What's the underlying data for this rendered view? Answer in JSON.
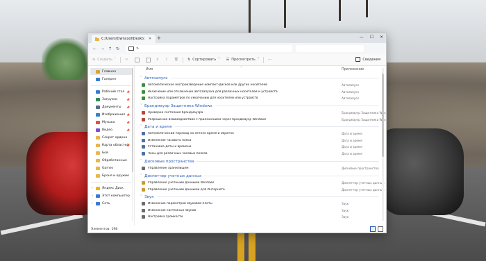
{
  "window": {
    "tab_title": "C:\\Users\\Owncool\\Desktop\\Go",
    "new_tab": "+",
    "controls": [
      "—",
      "☐",
      "✕"
    ]
  },
  "address": {
    "path_separator": ">"
  },
  "toolbar": {
    "create_label": "Создать",
    "sort_label": "Сортировать",
    "view_label": "Просмотреть",
    "more_label": "···",
    "details_label": "Сведения"
  },
  "sidebar": {
    "items": [
      {
        "label": "Главная",
        "icon": "home-icon",
        "color": "#d7a437",
        "selected": true
      },
      {
        "label": "Галерея",
        "icon": "gallery-icon",
        "color": "#3a7bd5"
      },
      {
        "label": "Рабочий стол",
        "icon": "desktop-icon",
        "color": "#3a7bd5",
        "pinned": true
      },
      {
        "label": "Загрузки",
        "icon": "downloads-icon",
        "color": "#2e8b57",
        "pinned": true
      },
      {
        "label": "Документы",
        "icon": "documents-icon",
        "color": "#5a6b86",
        "pinned": true
      },
      {
        "label": "Изображения",
        "icon": "pictures-icon",
        "color": "#2f86c9",
        "pinned": true
      },
      {
        "label": "Музыка",
        "icon": "music-icon",
        "color": "#d9534f",
        "pinned": true
      },
      {
        "label": "Видео",
        "icon": "video-icon",
        "color": "#7b4fc9",
        "pinned": true
      },
      {
        "label": "Секрет ордена",
        "icon": "folder-icon",
        "color": "#e8b64a"
      },
      {
        "label": "Карта областей",
        "icon": "folder-icon",
        "color": "#e8b64a",
        "pinned": true
      },
      {
        "label": "Бой",
        "icon": "folder-icon",
        "color": "#e8b64a"
      },
      {
        "label": "Обработанные",
        "icon": "folder-icon",
        "color": "#e8b64a"
      },
      {
        "label": "Games",
        "icon": "folder-icon",
        "color": "#e8b64a"
      },
      {
        "label": "Броня и оружие",
        "icon": "folder-icon",
        "color": "#e8b64a"
      },
      {
        "label": "Яндекс Диск",
        "icon": "cloud-icon",
        "color": "#f0b400"
      },
      {
        "label": "Этот компьютер",
        "icon": "computer-icon",
        "color": "#3a7bd5"
      },
      {
        "label": "Сеть",
        "icon": "network-icon",
        "color": "#3a7bd5"
      }
    ]
  },
  "columns": {
    "name": "Имя",
    "app": "Приложение",
    "sort_indicator": "^"
  },
  "groups": [
    {
      "title": "Автозапуск",
      "rows": [
        {
          "name": "Автоматическое воспроизведение компакт-дисков или других носителей",
          "app": "Автозапуск"
        },
        {
          "name": "Включение или отключение автозапуска для различных носителей и устройств",
          "app": "Автозапуск"
        },
        {
          "name": "Настройка параметров по умолчанию для носителей или устройств",
          "app": "Автозапуск"
        }
      ],
      "icon_color": "#3b8f3b"
    },
    {
      "title": "Брандмауэр Защитника Windows",
      "rows": [
        {
          "name": "Проверка состояния брандмауэра",
          "app": "Брандмауэр Защитника Wind"
        },
        {
          "name": "Разрешение взаимодействия с приложением через брандмауэр Windows",
          "app": "Брандмауэр Защитника Wind"
        }
      ],
      "icon_color": "#b5473a"
    },
    {
      "title": "Дата и время",
      "rows": [
        {
          "name": "Автоматический переход на летнее время и обратно",
          "app": "Дата и время"
        },
        {
          "name": "Изменение часового пояса",
          "app": "Дата и время"
        },
        {
          "name": "Установка даты и времени",
          "app": "Дата и время"
        },
        {
          "name": "Часы для различных часовых поясов",
          "app": "Дата и время"
        }
      ],
      "icon_color": "#4a6fa5"
    },
    {
      "title": "Дисковые пространства",
      "rows": [
        {
          "name": "Управление хранилищем",
          "app": "Дисковые пространства"
        }
      ],
      "icon_color": "#6b6b6b"
    },
    {
      "title": "Диспетчер учетных данных",
      "rows": [
        {
          "name": "Управление учетными данными Windows",
          "app": "Диспетчер учетных данных"
        },
        {
          "name": "Управление учетными данными для Интернета",
          "app": "Диспетчер учетных данных"
        }
      ],
      "icon_color": "#c99a2e"
    },
    {
      "title": "Звук",
      "rows": [
        {
          "name": "Изменение параметров звуковой платы",
          "app": "Звук"
        },
        {
          "name": "Изменение системных звуков",
          "app": "Звук"
        },
        {
          "name": "Настройка громкости",
          "app": "Звук"
        }
      ],
      "icon_color": "#6b6b6b"
    }
  ],
  "status": {
    "text": "Элементов: 198"
  },
  "colors": {
    "accent": "#2a5cb8",
    "window_bg": "#ffffff",
    "titlebar_bg": "#dfe3e8"
  }
}
